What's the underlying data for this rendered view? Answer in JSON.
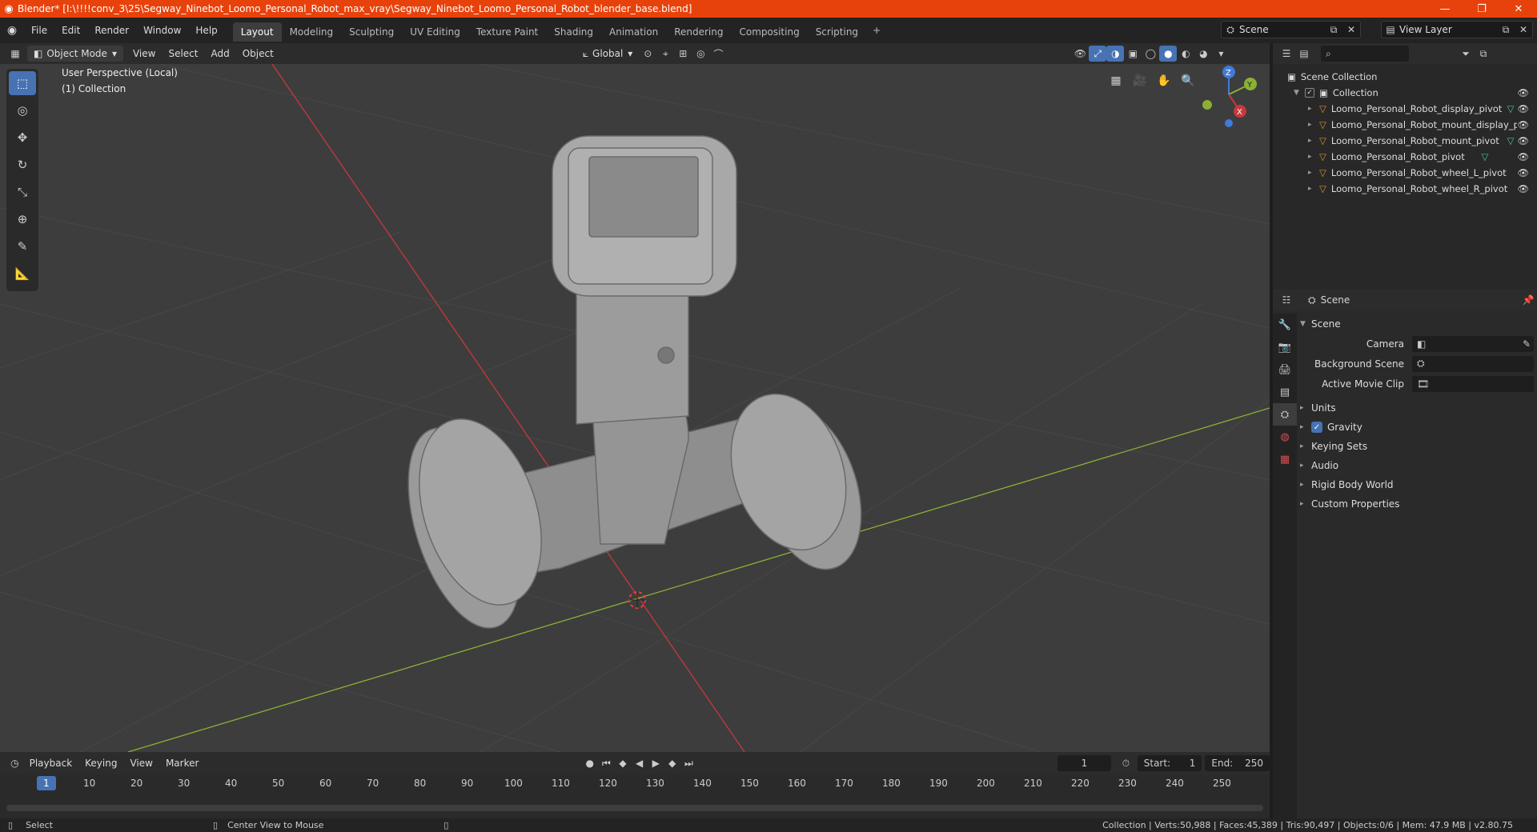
{
  "titlebar": {
    "title": "Blender* [I:\\!!!!conv_3\\25\\Segway_Ninebot_Loomo_Personal_Robot_max_vray\\Segway_Ninebot_Loomo_Personal_Robot_blender_base.blend]",
    "logo": "blender-logo"
  },
  "menu": {
    "items": [
      "File",
      "Edit",
      "Render",
      "Window",
      "Help"
    ]
  },
  "workspaces": [
    "Layout",
    "Modeling",
    "Sculpting",
    "UV Editing",
    "Texture Paint",
    "Shading",
    "Animation",
    "Rendering",
    "Compositing",
    "Scripting"
  ],
  "scene": {
    "name": "Scene",
    "view_layer": "View Layer"
  },
  "viewport_header": {
    "mode": "Object Mode",
    "menus": [
      "View",
      "Select",
      "Add",
      "Object"
    ],
    "orientation": "Global"
  },
  "viewport": {
    "perspective": "User Perspective (Local)",
    "collection": "(1) Collection"
  },
  "outliner": {
    "root": "Scene Collection",
    "collection": "Collection",
    "objects": [
      "Loomo_Personal_Robot_display_pivot",
      "Loomo_Personal_Robot_mount_display_pivo",
      "Loomo_Personal_Robot_mount_pivot",
      "Loomo_Personal_Robot_pivot",
      "Loomo_Personal_Robot_wheel_L_pivot",
      "Loomo_Personal_Robot_wheel_R_pivot"
    ]
  },
  "properties": {
    "header": "Scene",
    "section": "Scene",
    "camera_label": "Camera",
    "bg_scene_label": "Background Scene",
    "movie_clip_label": "Active Movie Clip",
    "panels": [
      "Units",
      "Gravity",
      "Keying Sets",
      "Audio",
      "Rigid Body World",
      "Custom Properties"
    ]
  },
  "timeline": {
    "menus": [
      "Playback",
      "Keying",
      "View",
      "Marker"
    ],
    "current_frame": "1",
    "start_label": "Start:",
    "start": "1",
    "end_label": "End:",
    "end": "250",
    "ticks": [
      "1",
      "10",
      "20",
      "30",
      "40",
      "50",
      "60",
      "70",
      "80",
      "90",
      "100",
      "110",
      "120",
      "130",
      "140",
      "150",
      "160",
      "170",
      "180",
      "190",
      "200",
      "210",
      "220",
      "230",
      "240",
      "250"
    ]
  },
  "status": {
    "select": "Select",
    "center": "Center View to Mouse",
    "stats": "Collection | Verts:50,988 | Faces:45,389 | Tris:90,497 | Objects:0/6 | Mem: 47.9 MB | v2.80.75"
  },
  "colors": {
    "accent": "#4772b3",
    "title": "#e8420c",
    "x_axis": "#c8383e",
    "y_axis": "#8bb036",
    "z_axis": "#3f7bd8",
    "object": "#e08a3a"
  }
}
